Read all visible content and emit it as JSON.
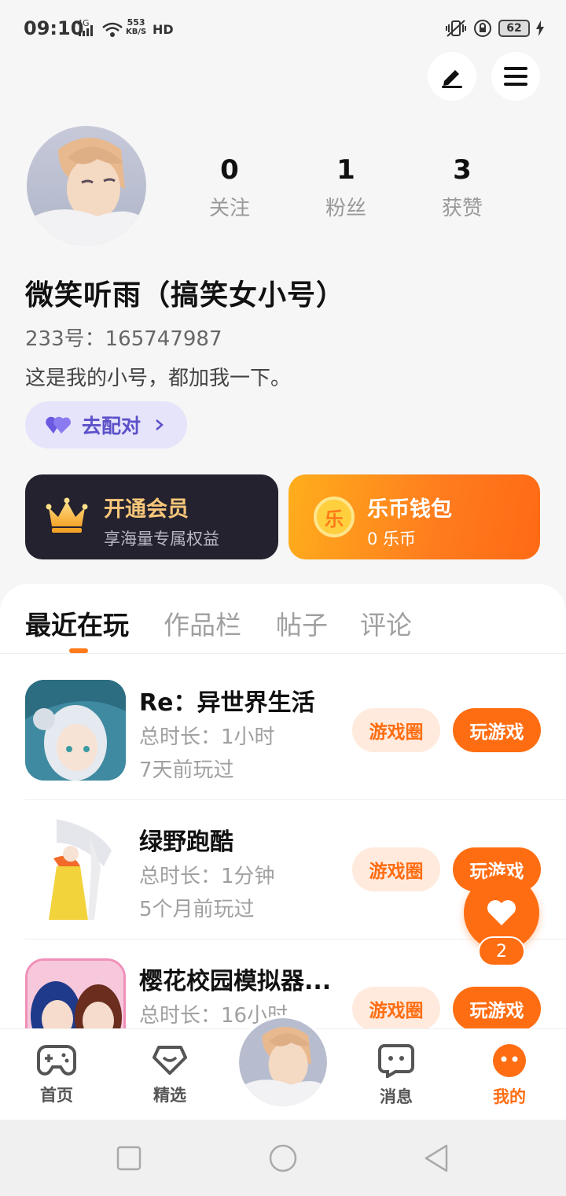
{
  "status_bar": {
    "time": "09:10",
    "network": "4G",
    "speed_value": "553",
    "speed_unit": "KB/S",
    "hd": "HD",
    "battery": "62"
  },
  "profile": {
    "stats": [
      {
        "value": "0",
        "label": "关注"
      },
      {
        "value": "1",
        "label": "粉丝"
      },
      {
        "value": "3",
        "label": "获赞"
      }
    ],
    "nickname": "微笑听雨（搞笑女小号）",
    "uid": "233号：165747987",
    "bio": "这是我的小号，都加我一下。",
    "pair_label": "去配对"
  },
  "cards": {
    "vip": {
      "title": "开通会员",
      "subtitle": "享海量专属权益"
    },
    "wallet": {
      "title": "乐币钱包",
      "subtitle": "0 乐币",
      "coin_glyph": "乐"
    }
  },
  "tabs": [
    "最近在玩",
    "作品栏",
    "帖子",
    "评论"
  ],
  "games": [
    {
      "title": "Re：异世界生活",
      "duration": "总时长：1小时",
      "last_played": "7天前玩过",
      "circle_label": "游戏圈",
      "play_label": "玩游戏"
    },
    {
      "title": "绿野跑酷",
      "duration": "总时长：1分钟",
      "last_played": "5个月前玩过",
      "circle_label": "游戏圈",
      "play_label": "玩游戏"
    },
    {
      "title": "樱花校园模拟器...",
      "duration": "总时长：16小时",
      "last_played": "",
      "circle_label": "游戏圈",
      "play_label": "玩游戏"
    }
  ],
  "floating_like": {
    "count": "2"
  },
  "bottom_nav": {
    "items": [
      {
        "label": "首页",
        "icon": "gamepad-icon"
      },
      {
        "label": "精选",
        "icon": "heart-box-icon"
      },
      {
        "label": "消息",
        "icon": "chat-icon"
      },
      {
        "label": "我的",
        "icon": "profile-icon"
      }
    ]
  },
  "colors": {
    "accent": "#ff6d12",
    "pair_bg": "#e6e4fb",
    "pair_text": "#5b51c9",
    "vip_bg": "#24222e",
    "vip_title": "#f8c77a"
  }
}
